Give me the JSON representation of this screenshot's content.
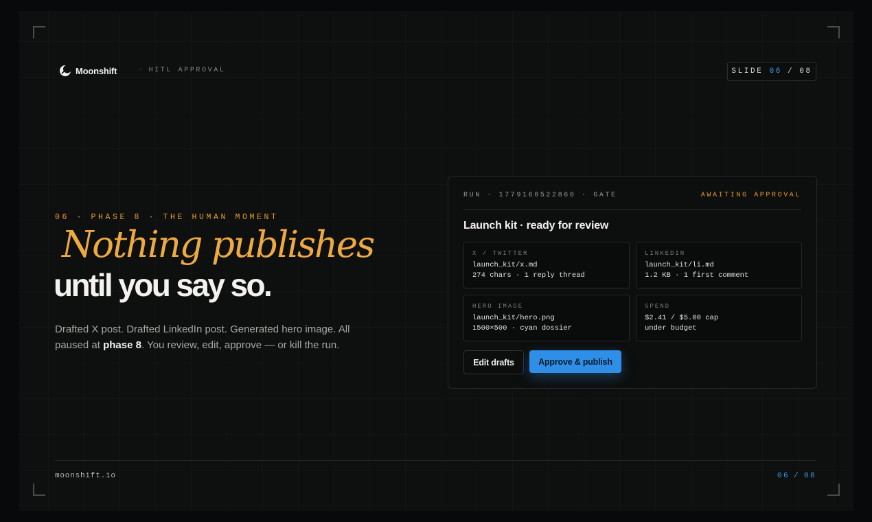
{
  "brand": {
    "name": "Moonshift",
    "logo_icon": "moonshift-logo-icon"
  },
  "header": {
    "section": "HITL APPROVAL",
    "slide_label": "SLIDE",
    "slide_current": "06",
    "slide_total": "08"
  },
  "hero": {
    "eyebrow": "06 · PHASE 8 · THE HUMAN MOMENT",
    "headline_italic": "Nothing publishes",
    "headline_bold": "until you say so.",
    "body_before": "Drafted X post. Drafted LinkedIn post. Generated hero image. All paused at ",
    "body_emphasis": "phase 8",
    "body_after": ". You review, edit, approve — or kill the run."
  },
  "card": {
    "run_id": "RUN · 1779160522860 · GATE",
    "status": "AWAITING APPROVAL",
    "title": "Launch kit · ready for review",
    "tiles": [
      {
        "label": "X / TWITTER",
        "line1": "launch_kit/x.md",
        "line2": "274 chars · 1 reply thread"
      },
      {
        "label": "LINKEDIN",
        "line1": "launch_kit/li.md",
        "line2": "1.2 KB · 1 first comment"
      },
      {
        "label": "HERO IMAGE",
        "line1": "launch_kit/hero.png",
        "line2": "1500×500 · cyan dossier"
      },
      {
        "label": "SPEND",
        "line1": "$2.41 / $5.00 cap",
        "line2": "under budget"
      }
    ],
    "edit_button": "Edit drafts",
    "approve_button": "Approve & publish"
  },
  "footer": {
    "url": "moonshift.io",
    "page_current": "06",
    "page_total": "08"
  },
  "colors": {
    "accent_amber": "#eeaa41",
    "accent_blue": "#2f8fe6",
    "background": "#0e0f0f"
  }
}
